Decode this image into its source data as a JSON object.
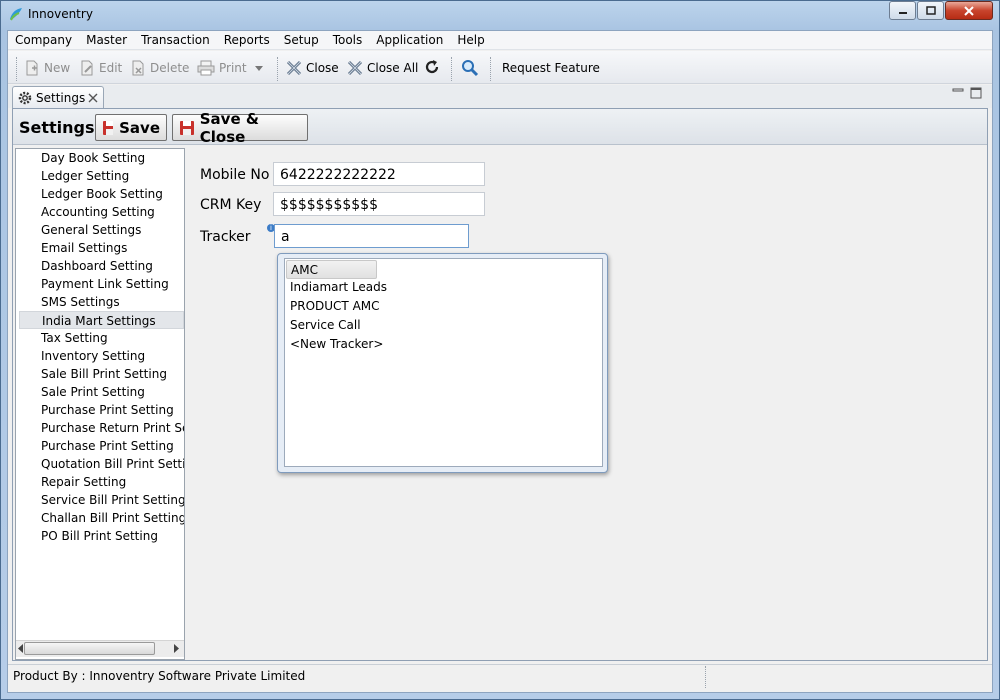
{
  "window": {
    "title": "Innoventry"
  },
  "menu": [
    "Company",
    "Master",
    "Transaction",
    "Reports",
    "Setup",
    "Tools",
    "Application",
    "Help"
  ],
  "toolbar": {
    "new": "New",
    "edit": "Edit",
    "delete": "Delete",
    "print": "Print",
    "close": "Close",
    "close_all": "Close All",
    "request_feature": "Request Feature"
  },
  "tab": {
    "label": "Settings"
  },
  "header": {
    "label": "Settings:",
    "save": "Save",
    "save_close": "Save & Close"
  },
  "settings_list": [
    "Day Book Setting",
    "Ledger Setting",
    "Ledger Book Setting",
    "Accounting Setting",
    "General Settings",
    "Email Settings",
    "Dashboard Setting",
    "Payment Link Setting",
    "SMS Settings",
    "India Mart Settings",
    "Tax Setting",
    "Inventory Setting",
    "Sale Bill Print Setting",
    "Sale Print Setting",
    "Purchase Print Setting",
    "Purchase Return Print Setting",
    "Purchase Print Setting",
    "Quotation Bill Print Setting",
    "Repair Setting",
    "Service Bill Print Setting",
    "Challan Bill Print Setting",
    "PO Bill Print Setting"
  ],
  "selected_setting": "India Mart Settings",
  "form": {
    "mobile_label": "Mobile No",
    "mobile_value": "6422222222222",
    "crm_label": "CRM Key",
    "crm_value": "$$$$$$$$$$$",
    "tracker_label": "Tracker",
    "tracker_value": "a"
  },
  "tracker_options": [
    "AMC",
    "Indiamart Leads",
    "PRODUCT AMC",
    "Service Call",
    "<New Tracker>"
  ],
  "status": {
    "text": "Product By : Innoventry Software Private Limited"
  }
}
